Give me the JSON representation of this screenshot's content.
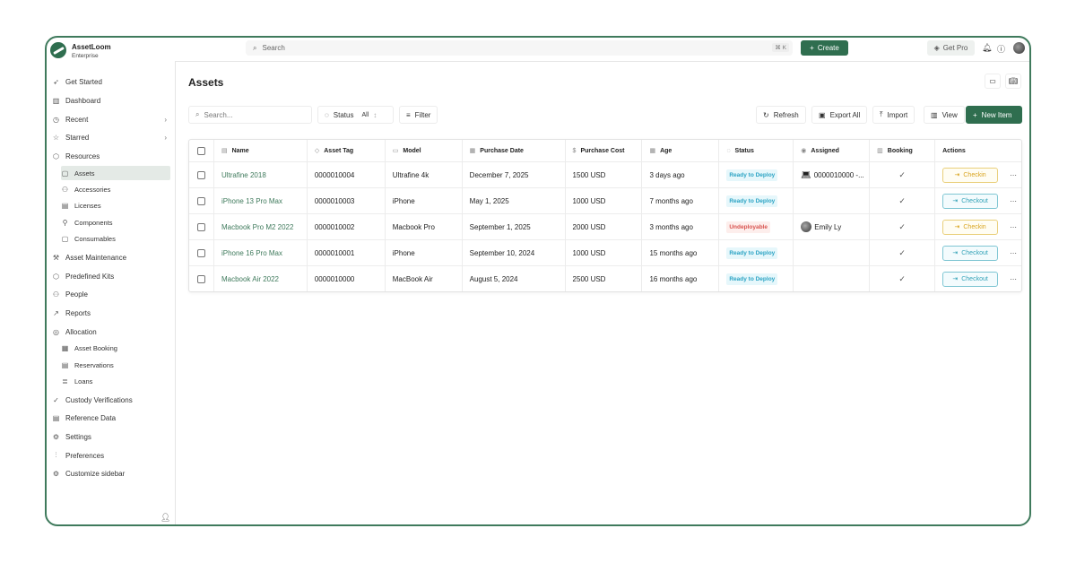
{
  "app": {
    "name": "AssetLoom",
    "edition": "Enterprise"
  },
  "topbar": {
    "search_placeholder": "Search",
    "shortcut": "⌘ K",
    "create_label": "Create",
    "get_pro_label": "Get Pro"
  },
  "sidebar": {
    "items": [
      {
        "label": "Get Started",
        "icon": "rocket-icon"
      },
      {
        "label": "Dashboard",
        "icon": "chart-icon"
      },
      {
        "label": "Recent",
        "icon": "clock-icon",
        "chevron": true
      },
      {
        "label": "Starred",
        "icon": "star-icon",
        "chevron": true
      },
      {
        "label": "Resources",
        "icon": "cube-icon"
      },
      {
        "label": "Assets",
        "icon": "asset-icon",
        "sub": true,
        "active": true
      },
      {
        "label": "Accessories",
        "icon": "accessories-icon",
        "sub": true
      },
      {
        "label": "Licenses",
        "icon": "license-icon",
        "sub": true
      },
      {
        "label": "Components",
        "icon": "component-icon",
        "sub": true
      },
      {
        "label": "Consumables",
        "icon": "consumable-icon",
        "sub": true
      },
      {
        "label": "Asset Maintenance",
        "icon": "wrench-icon"
      },
      {
        "label": "Predefined Kits",
        "icon": "kit-icon"
      },
      {
        "label": "People",
        "icon": "people-icon"
      },
      {
        "label": "Reports",
        "icon": "trend-icon"
      },
      {
        "label": "Allocation",
        "icon": "allocation-icon"
      },
      {
        "label": "Asset Booking",
        "icon": "calendar-icon",
        "sub": true
      },
      {
        "label": "Reservations",
        "icon": "reservation-icon",
        "sub": true
      },
      {
        "label": "Loans",
        "icon": "loan-icon",
        "sub": true
      },
      {
        "label": "Custody Verifications",
        "icon": "check-circle-icon"
      },
      {
        "label": "Reference Data",
        "icon": "database-icon"
      },
      {
        "label": "Settings",
        "icon": "gear-icon"
      },
      {
        "label": "Preferences",
        "icon": "sliders-icon"
      },
      {
        "label": "Customize sidebar",
        "icon": "gear-icon"
      }
    ]
  },
  "page": {
    "title": "Assets",
    "search_placeholder": "Search...",
    "status_label": "Status",
    "status_value": "All",
    "filter_label": "Filter",
    "refresh_label": "Refresh",
    "export_label": "Export All",
    "import_label": "Import",
    "view_label": "View",
    "new_item_label": "New Item"
  },
  "table": {
    "headers": [
      "Name",
      "Asset Tag",
      "Model",
      "Purchase Date",
      "Purchase Cost",
      "Age",
      "Status",
      "Assigned",
      "Booking",
      "Actions"
    ],
    "rows": [
      {
        "name": "Ultrafine 2018",
        "tag": "0000010004",
        "model": "Ultrafine 4k",
        "date": "December 7, 2025",
        "cost": "1500 USD",
        "age": "3 days ago",
        "status": "Ready to Deploy",
        "assigned": "0000010000 -...",
        "assigned_type": "device",
        "booking": "✓",
        "action": "Checkin"
      },
      {
        "name": "iPhone 13 Pro Max",
        "tag": "0000010003",
        "model": "iPhone",
        "date": "May 1, 2025",
        "cost": "1000 USD",
        "age": "7 months ago",
        "status": "Ready to Deploy",
        "assigned": "",
        "assigned_type": "",
        "booking": "✓",
        "action": "Checkout"
      },
      {
        "name": "Macbook Pro M2 2022",
        "tag": "0000010002",
        "model": "Macbook Pro",
        "date": "September 1, 2025",
        "cost": "2000 USD",
        "age": "3 months ago",
        "status": "Undeployable",
        "assigned": "Emily Ly",
        "assigned_type": "user",
        "booking": "✓",
        "action": "Checkin"
      },
      {
        "name": "iPhone 16 Pro Max",
        "tag": "0000010001",
        "model": "iPhone",
        "date": "September 10, 2024",
        "cost": "1000 USD",
        "age": "15 months ago",
        "status": "Ready to Deploy",
        "assigned": "",
        "assigned_type": "",
        "booking": "✓",
        "action": "Checkout"
      },
      {
        "name": "Macbook Air 2022",
        "tag": "0000010000",
        "model": "MacBook Air",
        "date": "August 5, 2024",
        "cost": "2500 USD",
        "age": "16 months ago",
        "status": "Ready to Deploy",
        "assigned": "",
        "assigned_type": "",
        "booking": "✓",
        "action": "Checkout"
      }
    ]
  },
  "colors": {
    "brand": "#2f6e4f",
    "ready": "#2ba3c4",
    "undeployable": "#d9534f"
  }
}
